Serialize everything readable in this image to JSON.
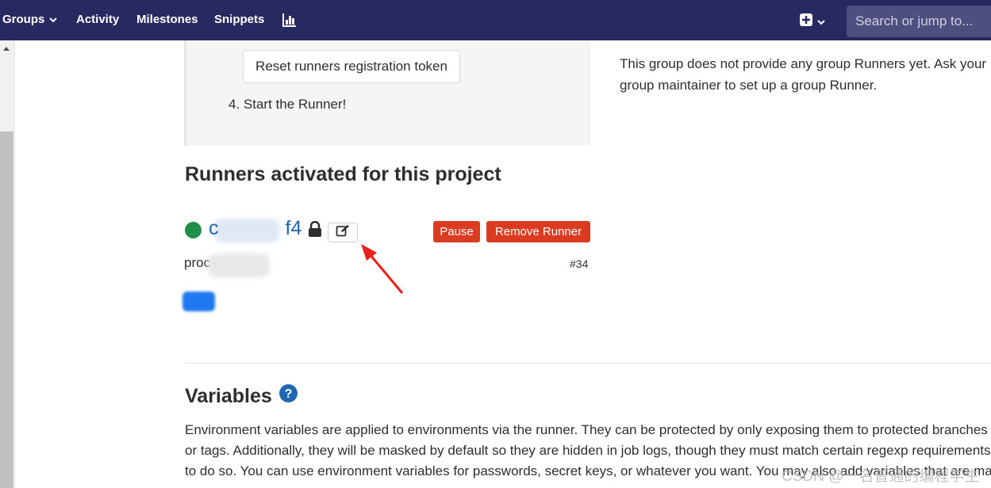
{
  "nav": {
    "groups": "Groups",
    "activity": "Activity",
    "milestones": "Milestones",
    "snippets": "Snippets",
    "search_placeholder": "Search or jump to..."
  },
  "instructions": {
    "reset_button": "Reset runners registration token",
    "step4": "4. Start the Runner!"
  },
  "group_runners_note": "This group does not provide any group Runners yet. Ask your group maintainer to set up a group Runner.",
  "runners": {
    "title": "Runners activated for this project",
    "runner_id_suffix": "f4",
    "pause_label": "Pause",
    "remove_label": "Remove Runner",
    "description_prefix": "proc",
    "runner_number": "#34"
  },
  "variables": {
    "title": "Variables",
    "line1": "Environment variables are applied to environments via the runner. They can be protected by only exposing them to protected branches",
    "line2": "or tags. Additionally, they will be masked by default so they are hidden in job logs, though they must match certain regexp requirements",
    "line3": "to do so. You can use environment variables for passwords, secret keys, or whatever you want. You may also add variables that are made"
  },
  "watermark": "CSDN @一名普通的编程学生",
  "colors": {
    "navbar": "#292961",
    "danger": "#db3b21",
    "status_online": "#1f8f4a",
    "link": "#1f67b1"
  }
}
